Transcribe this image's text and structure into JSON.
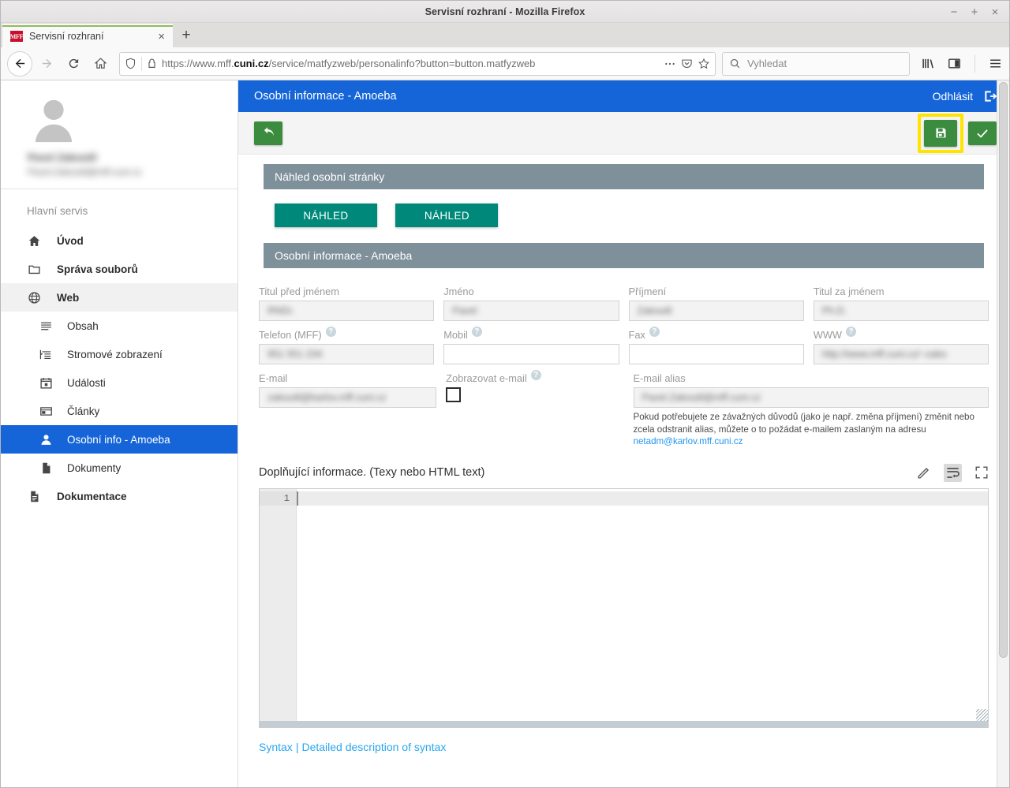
{
  "browser": {
    "window_title": "Servisní rozhraní - Mozilla Firefox",
    "minimize": "−",
    "maximize": "+",
    "close": "×",
    "tab": {
      "favicon_text": "MFF",
      "title": "Servisní rozhraní",
      "close": "×"
    },
    "new_tab": "+",
    "url": {
      "prefix": "https://www.mff.",
      "domain": "cuni.cz",
      "path": "/service/matfyzweb/personalinfo?button=button.matfyzweb"
    },
    "search_placeholder": "Vyhledat",
    "nav": {
      "back": "←",
      "forward": "→",
      "reload": "⟳",
      "home": "⌂"
    }
  },
  "sidebar": {
    "profile": {
      "name": "Pavel Zakoutil",
      "email": "Pavel.Zakoutil@mff.cuni.cz"
    },
    "group_title": "Hlavní servis",
    "items": [
      {
        "label": "Úvod",
        "icon": "home-icon",
        "level": "top"
      },
      {
        "label": "Správa souborů",
        "icon": "folder-icon",
        "level": "top"
      },
      {
        "label": "Web",
        "icon": "globe-icon",
        "level": "top"
      },
      {
        "label": "Obsah",
        "icon": "list-icon",
        "level": "sub"
      },
      {
        "label": "Stromové zobrazení",
        "icon": "tree-icon",
        "level": "sub"
      },
      {
        "label": "Události",
        "icon": "calendar-icon",
        "level": "sub"
      },
      {
        "label": "Články",
        "icon": "article-icon",
        "level": "sub"
      },
      {
        "label": "Osobní info - Amoeba",
        "icon": "person-icon",
        "level": "sub"
      },
      {
        "label": "Dokumenty",
        "icon": "document-icon",
        "level": "sub"
      },
      {
        "label": "Dokumentace",
        "icon": "documentation-icon",
        "level": "top"
      }
    ]
  },
  "app": {
    "header_title": "Osobní informace - Amoeba",
    "logout_label": "Odhlásit",
    "toolbar": {
      "back_label": "",
      "save_label": "",
      "confirm_label": ""
    },
    "colors": {
      "header_blue": "#1565d8",
      "panel_grey": "#7e909a",
      "teal_button": "#00897b",
      "green_button": "#3c8c40",
      "highlight_yellow": "#ffe400",
      "link_blue": "#29a7f0"
    }
  },
  "preview_panel": {
    "title": "Náhled osobní stránky",
    "buttons": [
      "NÁHLED",
      "NÁHLED"
    ]
  },
  "info_panel": {
    "title": "Osobní informace - Amoeba",
    "fields": {
      "row1": [
        {
          "label": "Titul před jménem",
          "value": "RNDr.",
          "has_help": false,
          "filled": true
        },
        {
          "label": "Jméno",
          "value": "Pavel",
          "has_help": false,
          "filled": true
        },
        {
          "label": "Příjmení",
          "value": "Zakoutil",
          "has_help": false,
          "filled": true
        },
        {
          "label": "Titul za jménem",
          "value": "Ph.D.",
          "has_help": false,
          "filled": true
        }
      ],
      "row2": [
        {
          "label": "Telefon (MFF)",
          "value": "951 551 234",
          "has_help": true,
          "filled": true
        },
        {
          "label": "Mobil",
          "value": "",
          "has_help": true,
          "filled": false
        },
        {
          "label": "Fax",
          "value": "",
          "has_help": true,
          "filled": false
        },
        {
          "label": "WWW",
          "value": "http://www.mff.cuni.cz/~zako",
          "has_help": true,
          "filled": true
        }
      ],
      "email": {
        "label": "E-mail",
        "value": "zakoutil@karlov.mff.cuni.cz",
        "filled": true
      },
      "show_email": {
        "label": "Zobrazovat e-mail",
        "has_help": true,
        "checked": false
      },
      "email_alias": {
        "label": "E-mail alias",
        "value": "Pavel.Zakoutil@mff.cuni.cz",
        "note": "Pokud potřebujete ze závažných důvodů (jako je např. změna příjmení) změnit nebo zcela odstranit alias, můžete o to požádat e-mailem zaslaným na adresu",
        "note_link": "netadm@karlov.mff.cuni.cz"
      }
    }
  },
  "editor": {
    "title": "Doplňující informace. (Texy nebo HTML text)",
    "tools": [
      "pencil-icon",
      "wrap-icon",
      "fullscreen-icon"
    ],
    "line_number": "1",
    "content": ""
  },
  "footer_links": {
    "syntax": "Syntax",
    "separator": "|",
    "detailed": "Detailed description of syntax"
  }
}
